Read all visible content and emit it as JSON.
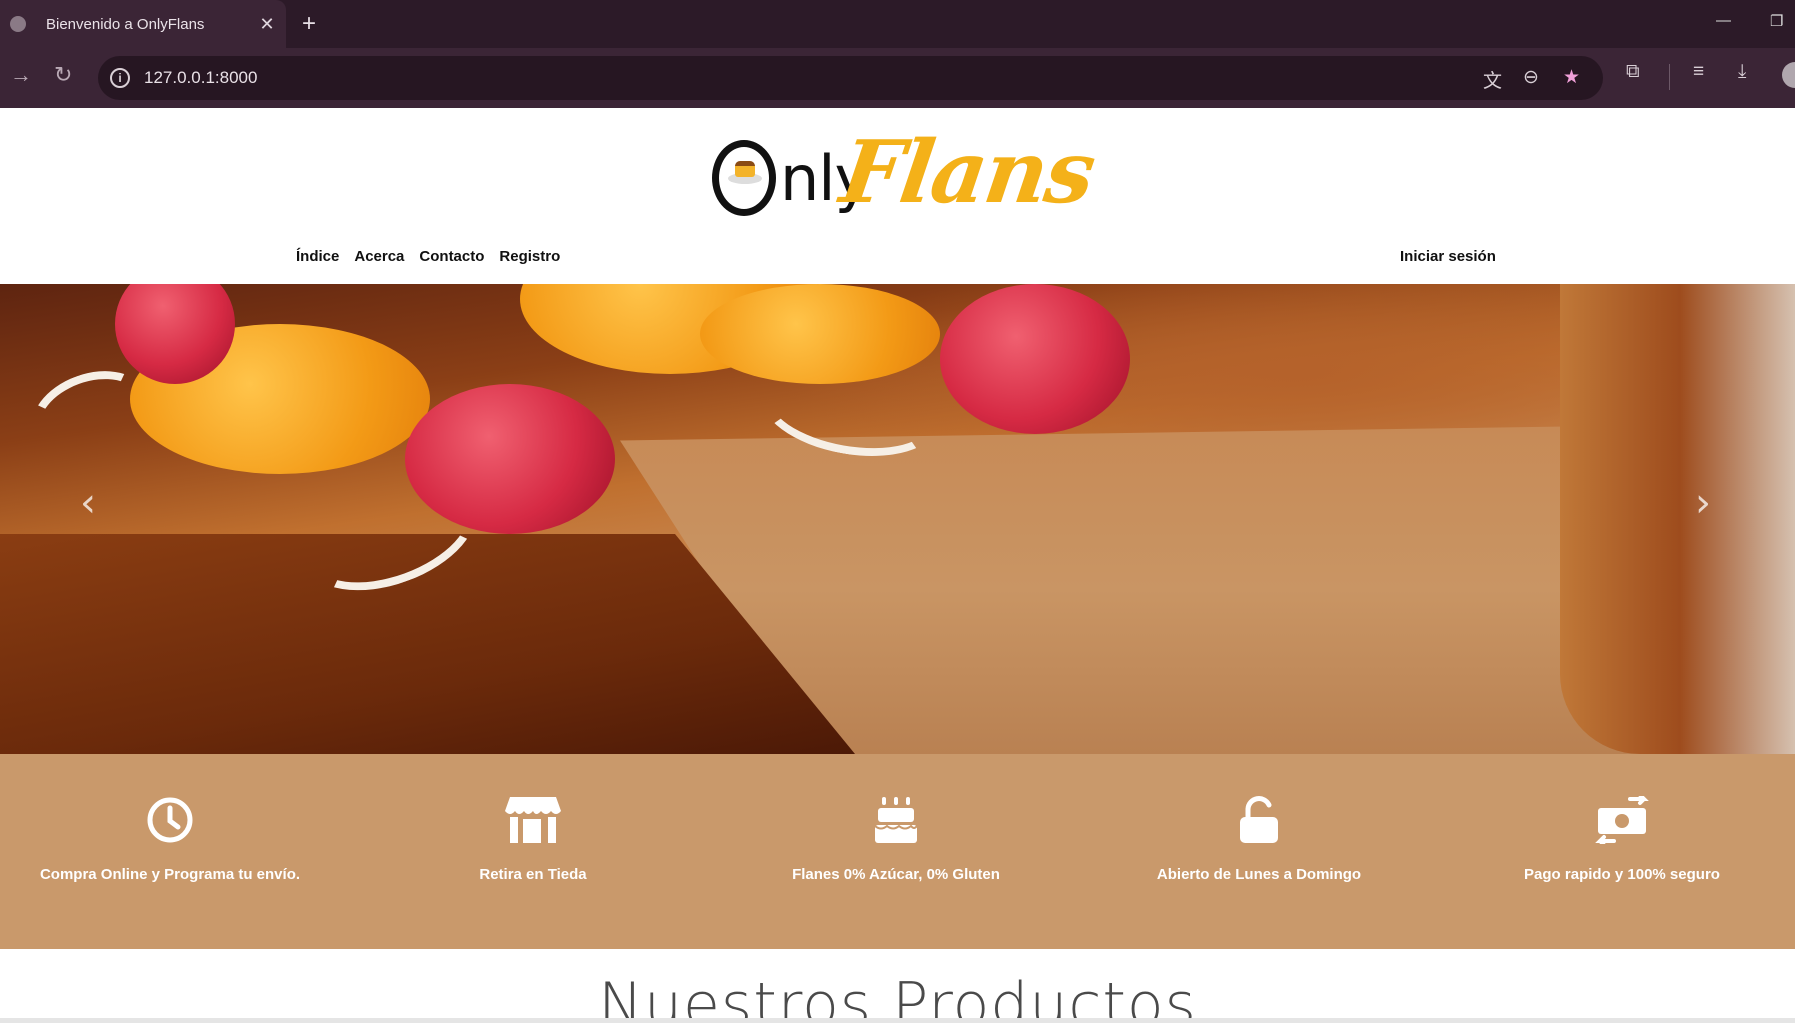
{
  "browser": {
    "tab_title": "Bienvenido a OnlyFlans",
    "url": "127.0.0.1:8000"
  },
  "site": {
    "logo": {
      "part1": "nly",
      "part2": "Flans",
      "accent": "#f4b119"
    },
    "nav": [
      "Índice",
      "Acerca",
      "Contacto",
      "Registro"
    ],
    "login": "Iniciar sesión"
  },
  "features": [
    {
      "icon": "clock-icon",
      "text": "Compra Online y Programa tu envío."
    },
    {
      "icon": "store-icon",
      "text": "Retira en Tieda"
    },
    {
      "icon": "cake-icon",
      "text": "Flanes 0% Azúcar, 0% Gluten"
    },
    {
      "icon": "unlock-icon",
      "text": "Abierto de Lunes a Domingo"
    },
    {
      "icon": "money-exchange-icon",
      "text": "Pago rapido y 100% seguro"
    }
  ],
  "section_title": "Nuestros Productos",
  "colors": {
    "feature_band": "#c9996b",
    "chrome_dark": "#2c1a28",
    "chrome": "#3b2536"
  }
}
